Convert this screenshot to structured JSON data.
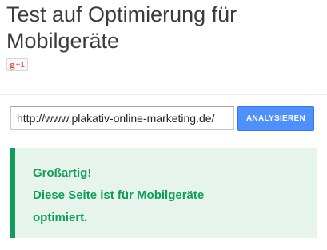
{
  "page": {
    "title_line1": "Test auf Optimierung für",
    "title_line2": "Mobilgeräte"
  },
  "social": {
    "gplus_g": "g",
    "gplus_plus": "+1",
    "icon": "google-plus-one-icon"
  },
  "form": {
    "url_value": "http://www.plakativ-online-marketing.de/",
    "analyze_label": "ANALYSIEREN"
  },
  "result": {
    "heading": "Großartig!",
    "message_line1": "Diese Seite ist für Mobilgeräte",
    "message_line2": "optimiert.",
    "status": "success"
  },
  "colors": {
    "accent_blue": "#4d90fe",
    "success_green": "#109d58",
    "success_bg": "#e6f4ec",
    "gplus_red": "#dd4b39"
  }
}
